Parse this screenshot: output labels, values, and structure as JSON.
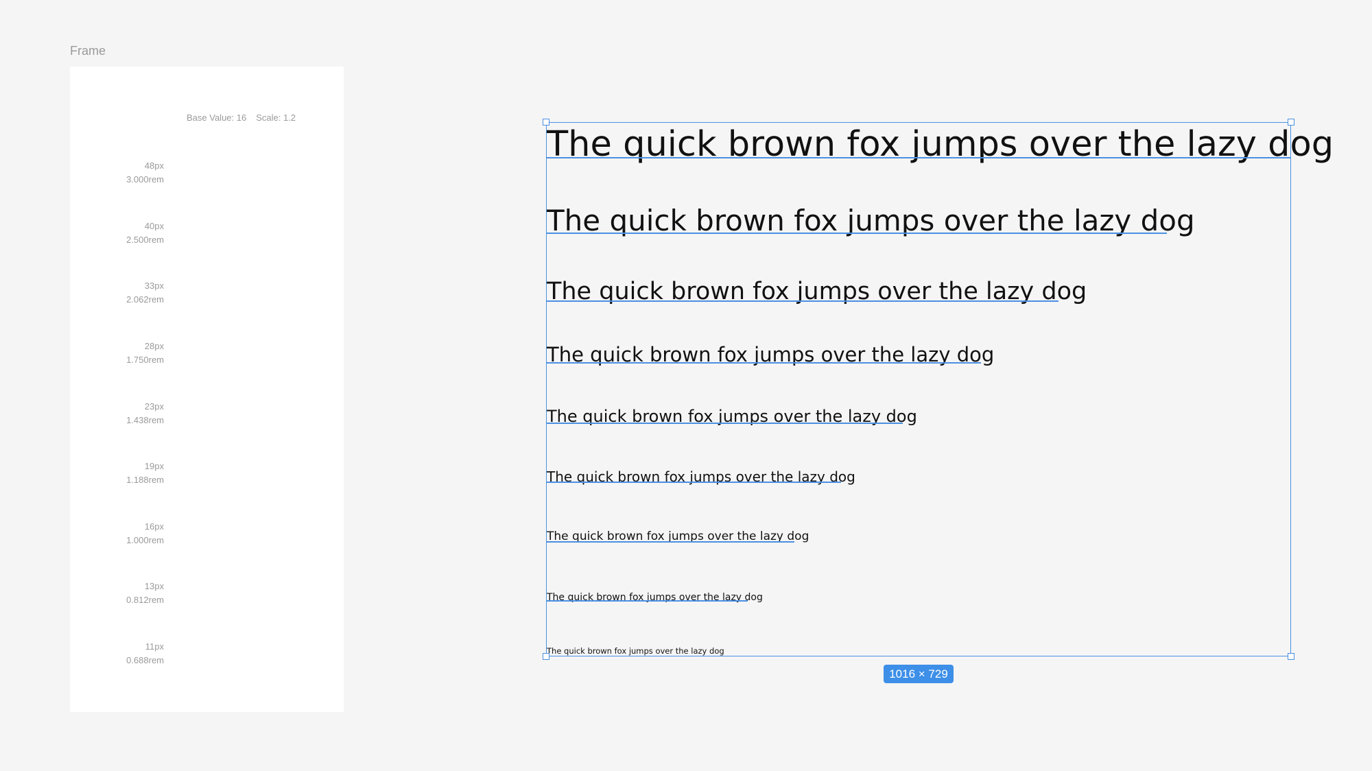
{
  "frame": {
    "label": "Frame",
    "base_value": "Base Value: 16",
    "scale": "Scale: 1.2",
    "steps": [
      {
        "px": "48px",
        "rem": "3.000rem"
      },
      {
        "px": "40px",
        "rem": "2.500rem"
      },
      {
        "px": "33px",
        "rem": "2.062rem"
      },
      {
        "px": "28px",
        "rem": "1.750rem"
      },
      {
        "px": "23px",
        "rem": "1.438rem"
      },
      {
        "px": "19px",
        "rem": "1.188rem"
      },
      {
        "px": "16px",
        "rem": "1.000rem"
      },
      {
        "px": "13px",
        "rem": "0.812rem"
      },
      {
        "px": "11px",
        "rem": "0.688rem"
      }
    ]
  },
  "samples": [
    "The quick brown fox jumps over the lazy dog",
    "The quick brown fox jumps over the lazy dog",
    "The quick brown fox jumps over the lazy dog",
    "The quick brown fox jumps over the lazy dog",
    "The quick brown fox jumps over the lazy dog",
    "The quick brown fox jumps over the lazy dog",
    "The quick brown fox jumps over the lazy dog",
    "The quick brown fox jumps over the lazy dog",
    "The quick brown fox jumps over the lazy dog"
  ],
  "selection": {
    "dimensions": "1016 × 729"
  },
  "colors": {
    "selection": "#4a90e2",
    "badge": "#3d8fe8",
    "canvas": "#f5f5f5",
    "text": "#111111",
    "muted": "#9a9a9a"
  }
}
